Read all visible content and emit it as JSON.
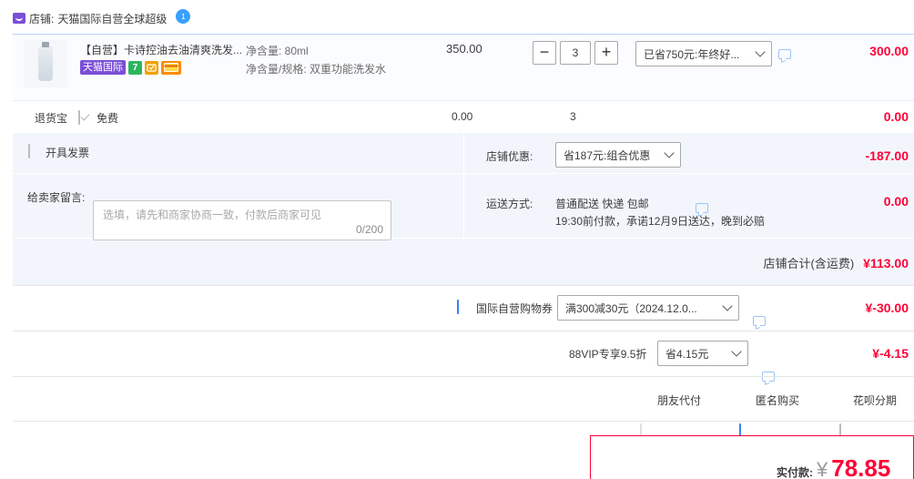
{
  "shop": {
    "label": "店铺:",
    "name": "天猫国际自营全球超级",
    "bubble_badge": "1"
  },
  "product": {
    "title": "【自营】卡诗控油去油清爽洗发...",
    "tag_platform": "天猫国际",
    "tag_seven": "7",
    "spec_line1": "净含量: 80ml",
    "spec_line2": "净含量/规格: 双重功能洗发水",
    "unit_price": "350.00",
    "qty_minus": "−",
    "qty_value": "3",
    "qty_plus": "+",
    "discount_select": "已省750元:年终好...",
    "subtotal": "300.00"
  },
  "return_service": {
    "label": "退货宝",
    "option": "免费",
    "price": "0.00",
    "qty": "3",
    "amount": "0.00"
  },
  "invoice": {
    "label": "开具发票"
  },
  "message": {
    "label": "给卖家留言:",
    "placeholder": "选填，请先和商家协商一致，付款后商家可见",
    "counter": "0/200"
  },
  "shop_discount": {
    "label": "店铺优惠:",
    "select": "省187元:组合优惠",
    "amount": "-187.00"
  },
  "shipping": {
    "label": "运送方式:",
    "line1": "普通配送 快递 包邮",
    "line2": "19:30前付款，承诺12月9日送达，晚到必赔",
    "amount": "0.00"
  },
  "shop_total": {
    "label": "店铺合计(含运费)",
    "amount": "¥113.00"
  },
  "intl_coupon": {
    "label": "国际自营购物券",
    "select": "满300减30元（2024.12.0...",
    "amount": "¥-30.00"
  },
  "vip": {
    "label": "88VIP专享9.5折",
    "select": "省4.15元",
    "amount": "¥-4.15"
  },
  "options": {
    "friend_pay": "朋友代付",
    "anonymous": "匿名购买",
    "huabei": "花呗分期"
  },
  "payment": {
    "label": "实付款:",
    "currency": "¥",
    "amount": "78.85"
  },
  "colors": {
    "accent_red": "#ff0036",
    "tmall_purple": "#7a4fd6",
    "check_blue": "#3b82f6",
    "panel_blue": "#f2f6fc"
  }
}
